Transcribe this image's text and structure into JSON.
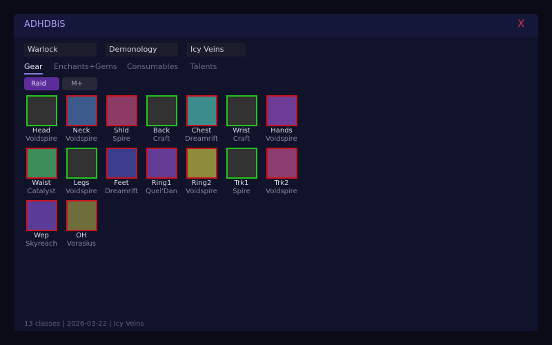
{
  "window": {
    "title": "ADHDBiS",
    "close_label": "X"
  },
  "selectors": {
    "class": "Warlock",
    "spec": "Demonology",
    "source": "Icy Veins"
  },
  "tabs": [
    {
      "label": "Gear",
      "active": true
    },
    {
      "label": "Enchants+Gems",
      "active": false
    },
    {
      "label": "Consumables",
      "active": false
    },
    {
      "label": "Talents",
      "active": false
    }
  ],
  "modes": [
    {
      "label": "Raid",
      "active": true
    },
    {
      "label": "M+",
      "active": false
    }
  ],
  "colors": {
    "border_green": "#23c41a",
    "border_red": "#c8141e"
  },
  "slots": [
    {
      "name": "Head",
      "source": "Voidspire",
      "fill": "#323232",
      "border": "green"
    },
    {
      "name": "Neck",
      "source": "Voidspire",
      "fill": "#3c5a8c",
      "border": "red"
    },
    {
      "name": "Shld",
      "source": "Spire",
      "fill": "#8c3c64",
      "border": "red"
    },
    {
      "name": "Back",
      "source": "Craft",
      "fill": "#323232",
      "border": "green"
    },
    {
      "name": "Chest",
      "source": "Dreamrift",
      "fill": "#3c8c8c",
      "border": "red"
    },
    {
      "name": "Wrist",
      "source": "Craft",
      "fill": "#323232",
      "border": "green"
    },
    {
      "name": "Hands",
      "source": "Voidspire",
      "fill": "#6e3c96",
      "border": "red"
    },
    {
      "name": "Waist",
      "source": "Catalyst",
      "fill": "#3c8c5a",
      "border": "red"
    },
    {
      "name": "Legs",
      "source": "Voidspire",
      "fill": "#323232",
      "border": "green"
    },
    {
      "name": "Feet",
      "source": "Dreamrift",
      "fill": "#3c3c8c",
      "border": "red"
    },
    {
      "name": "Ring1",
      "source": "Quel'Dan",
      "fill": "#643c96",
      "border": "red"
    },
    {
      "name": "Ring2",
      "source": "Voidspire",
      "fill": "#8c8c3c",
      "border": "red"
    },
    {
      "name": "Trk1",
      "source": "Spire",
      "fill": "#323232",
      "border": "green"
    },
    {
      "name": "Trk2",
      "source": "Voidspire",
      "fill": "#8c3c6e",
      "border": "red"
    },
    {
      "name": "Wep",
      "source": "Skyreach",
      "fill": "#5a3c96",
      "border": "red"
    },
    {
      "name": "OH",
      "source": "Vorasius",
      "fill": "#6e6e3c",
      "border": "red"
    }
  ],
  "footer": {
    "status": "13 classes | 2026-03-22 | Icy Veins"
  }
}
